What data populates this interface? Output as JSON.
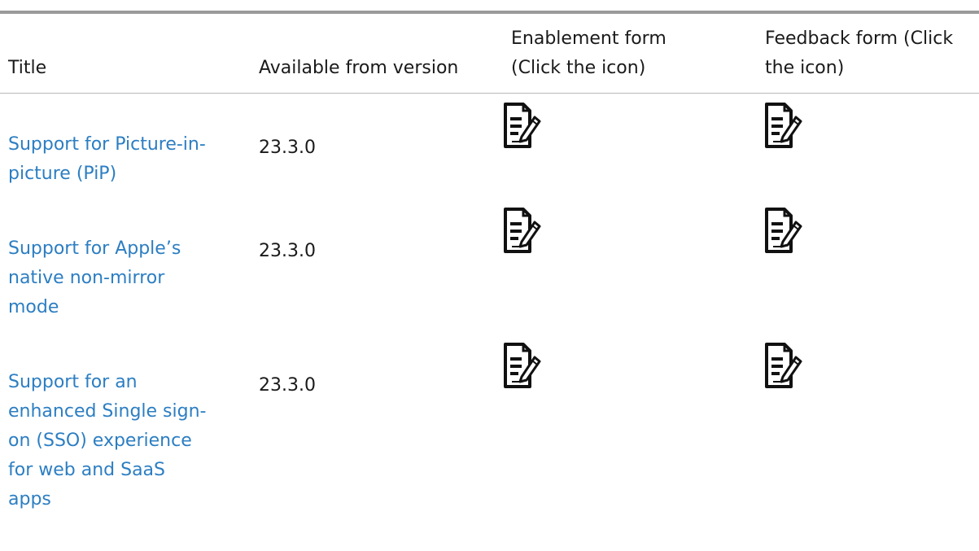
{
  "table": {
    "headers": {
      "title": "Title",
      "version": "Available from version",
      "enablement_line1": "Enablement form",
      "enablement_line2": "(Click the icon)",
      "feedback_line1": "Feedback form (Click",
      "feedback_line2": "the icon)"
    },
    "rows": [
      {
        "title": "Support for Picture-in-picture (PiP)",
        "version": "23.3.0",
        "enablement_icon": "form-edit-icon",
        "feedback_icon": "form-edit-icon"
      },
      {
        "title": "Support for Apple’s native non-mirror mode",
        "version": "23.3.0",
        "enablement_icon": "form-edit-icon",
        "feedback_icon": "form-edit-icon"
      },
      {
        "title": "Support for an enhanced Single sign-on (SSO) experience for web and SaaS apps",
        "version": "23.3.0",
        "enablement_icon": "form-edit-icon",
        "feedback_icon": "form-edit-icon"
      }
    ]
  },
  "colors": {
    "link": "#2c7ec2",
    "text": "#1a1a1a",
    "rule": "#9a9a9a"
  }
}
